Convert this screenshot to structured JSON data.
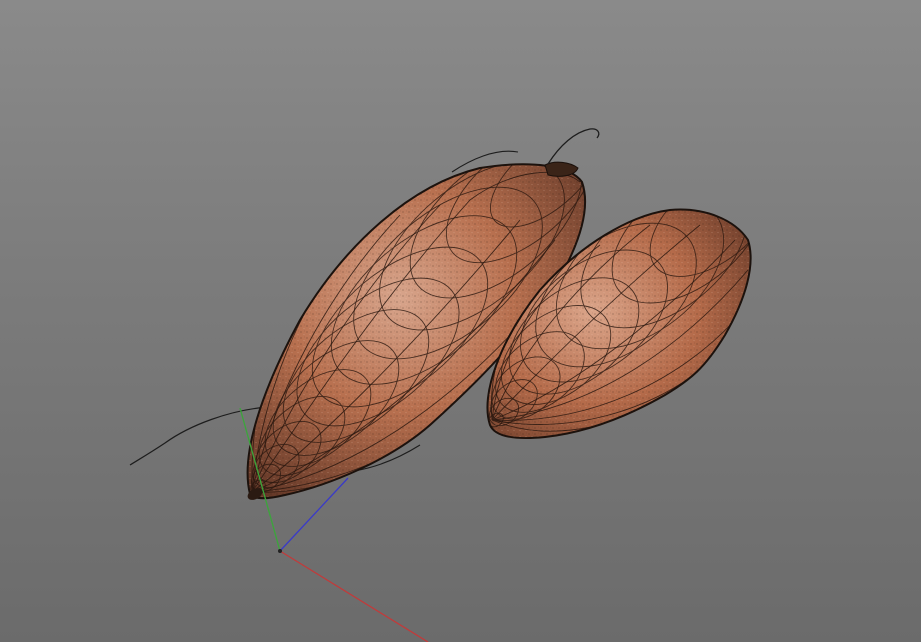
{
  "scene": {
    "background_top": "#8a8a8a",
    "background_bottom": "#6b6b6b",
    "objects": [
      {
        "name": "sweet-potato-large",
        "skin_color": "#b0664a",
        "wire_color": "#2a1a14"
      },
      {
        "name": "sweet-potato-small",
        "skin_color": "#b86a4c",
        "wire_color": "#2a1a14"
      }
    ],
    "gizmo": {
      "x_axis_color": "#c23a3a",
      "y_axis_color": "#3aa63a",
      "z_axis_color": "#3a3ac8"
    }
  }
}
